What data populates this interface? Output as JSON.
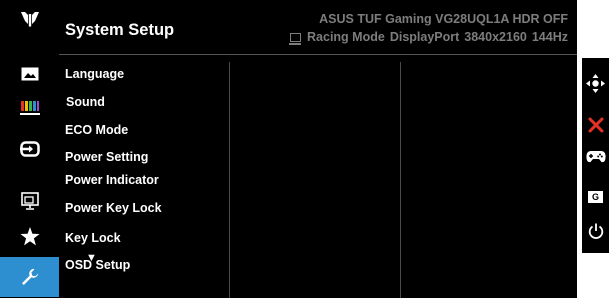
{
  "header": {
    "title": "System Setup",
    "model": "ASUS TUF Gaming VG28UQL1A HDR OFF",
    "mode": "Racing Mode",
    "input": "DisplayPort",
    "resolution": "3840x2160",
    "refresh": "144Hz"
  },
  "menu": {
    "items": [
      {
        "label": "Language"
      },
      {
        "label": "Sound"
      },
      {
        "label": "ECO Mode"
      },
      {
        "label": "Power Setting"
      },
      {
        "label": "Power Indicator"
      },
      {
        "label": "Power Key Lock"
      },
      {
        "label": "Key Lock"
      },
      {
        "label": "OSD Setup"
      }
    ],
    "more_indicator": "▼"
  },
  "sidebar": {
    "icons": [
      "tuf-logo-icon",
      "image-icon",
      "color-icon",
      "input-select-icon",
      "pip-pbp-icon",
      "favorite-star-icon",
      "system-setup-wrench-icon"
    ],
    "selected": "system-setup-wrench-icon",
    "selected_color": "#2d8fd0"
  },
  "buttons": {
    "icons": [
      "five-way-navigation-icon",
      "close-icon",
      "gamepad-icon",
      "g-key-icon",
      "power-icon"
    ],
    "g_key_label": "G",
    "close_color": "#e53227"
  }
}
